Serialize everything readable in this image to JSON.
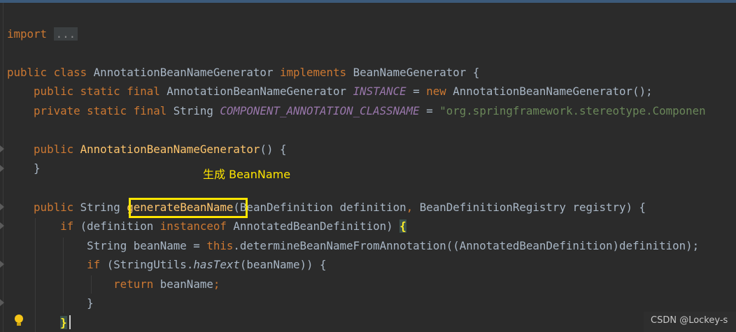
{
  "annotation": "生成 BeanName",
  "watermark": "CSDN @Lockey-s",
  "code": {
    "import_kw": "import",
    "import_fold": "...",
    "class_decl": {
      "public": "public",
      "class": "class",
      "name": "AnnotationBeanNameGenerator",
      "implements": "implements",
      "iface": "BeanNameGenerator",
      "brace": "{"
    },
    "instance_line": {
      "mods": "public static final",
      "type": "AnnotationBeanNameGenerator",
      "field": "INSTANCE",
      "eq": "=",
      "new": "new",
      "ctor": "AnnotationBeanNameGenerator();"
    },
    "classname_line": {
      "mods": "private static final",
      "type": "String",
      "field": "COMPONENT_ANNOTATION_CLASSNAME",
      "eq": "=",
      "value": "\"org.springframework.stereotype.Componen"
    },
    "ctor_line": {
      "public": "public",
      "name": "AnnotationBeanNameGenerator",
      "rest": "() {"
    },
    "ctor_close": "}",
    "method_line": {
      "public": "public",
      "type": "String",
      "name": "generateBeanName",
      "params": "(BeanDefinition definition",
      "comma": ",",
      "params2": " BeanDefinitionRegistry registry) {"
    },
    "if_line": {
      "if": "if",
      "cond1": "(definition",
      "instanceof": "instanceof",
      "cond2": "AnnotatedBeanDefinition)",
      "brace": "{"
    },
    "assign_line": {
      "text1": "String beanName = ",
      "this": "this",
      "text2": ".determineBeanNameFromAnnotation((AnnotatedBeanDefinition)definition);"
    },
    "inner_if_line": {
      "if": "if",
      "text1": "(StringUtils.",
      "call": "hasText",
      "text2": "(beanName)) {"
    },
    "return_line": {
      "return": "return",
      "text": "beanName",
      "semi": ";"
    },
    "inner_close": "}",
    "outer_close": "}"
  }
}
